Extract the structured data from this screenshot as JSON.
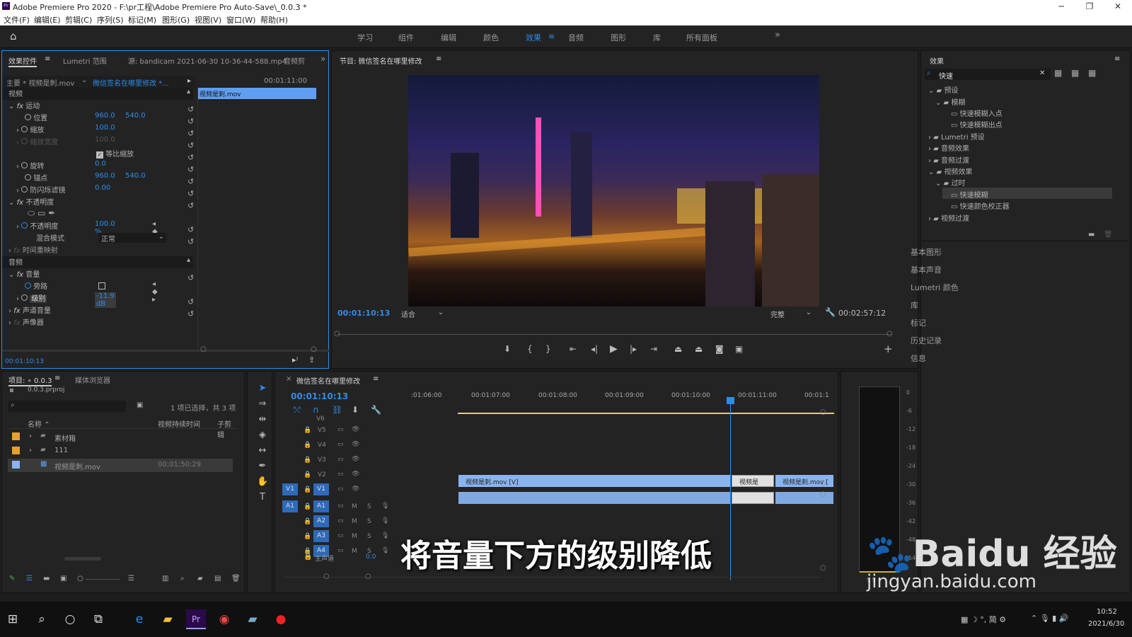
{
  "titlebar": {
    "title": "Adobe Premiere Pro 2020 - F:\\pr工程\\Adobe Premiere Pro Auto-Save\\_0.0.3 *",
    "minimize": "─",
    "maximize": "❐",
    "close": "✕"
  },
  "menu": [
    "文件(F)",
    "编辑(E)",
    "剪辑(C)",
    "序列(S)",
    "标记(M)",
    "图形(G)",
    "视图(V)",
    "窗口(W)",
    "帮助(H)"
  ],
  "workspaces": [
    "学习",
    "组件",
    "编辑",
    "颜色",
    "效果",
    "音频",
    "图形",
    "库",
    "所有面板"
  ],
  "workspace_more": "»",
  "effect_controls": {
    "tabs": [
      "效果控件",
      "Lumetri 范围",
      "源: bandicam 2021-06-30 10-36-44-588.mp4",
      "音频剪"
    ],
    "master": "主要 * 视频是刺.mov",
    "sequence": "微信签名在哪里修改 *...",
    "ruler_time": "00:01:11:00",
    "clip_label": "视频是刺.mov",
    "section_video": "视频",
    "section_audio": "音频",
    "motion": "运动",
    "position": "位置",
    "position_x": "960.0",
    "position_y": "540.0",
    "scale": "缩放",
    "scale_val": "100.0",
    "scale_width": "缩放宽度",
    "scale_width_val": "100.0",
    "uniform": "等比缩放",
    "rotation": "旋转",
    "rotation_val": "0.0",
    "anchor": "锚点",
    "anchor_x": "960.0",
    "anchor_y": "540.0",
    "flicker": "防闪烁滤镜",
    "flicker_val": "0.00",
    "opacity": "不透明度",
    "opacity_prop": "不透明度",
    "opacity_val": "100.0 %",
    "blend": "混合模式",
    "blend_val": "正常",
    "timeremap": "时间重映射",
    "volume": "音量",
    "bypass": "旁路",
    "level": "级别",
    "level_val": "-11.9 dB",
    "channel_vol": "声道音量",
    "panner": "声像器",
    "current_time": "00:01:10:13"
  },
  "program": {
    "title": "节目: 微信签名在哪里修改",
    "timecode": "00:01:10:13",
    "fit": "适合",
    "quality": "完整",
    "duration": "00:02:57:12"
  },
  "effects": {
    "title": "效果",
    "search": "快速",
    "tree": [
      "预设",
      "模糊",
      "快速模糊入点",
      "快速模糊出点",
      "Lumetri 预设",
      "音频效果",
      "音频过渡",
      "视频效果",
      "过时",
      "快速模糊",
      "快速颜色校正器",
      "视频过渡"
    ],
    "side_panels": [
      "基本图形",
      "基本声音",
      "Lumetri 颜色",
      "库",
      "标记",
      "历史记录",
      "信息"
    ]
  },
  "project": {
    "tabs": [
      "项目: ∘ 0.0.3",
      "媒体浏览器"
    ],
    "file": "0.0.3.prproj",
    "selection": "1 项已选择，共 3 项",
    "cols": [
      "名称",
      "视频持续时间",
      "子剪辑"
    ],
    "items": [
      {
        "name": "素材箱",
        "dur": "",
        "color": "#e8a030"
      },
      {
        "name": "111",
        "dur": "",
        "color": "#e8a030"
      },
      {
        "name": "视频是刺.mov",
        "dur": "00;01;50;29",
        "color": "#8ab4f0"
      }
    ]
  },
  "timeline": {
    "title": "微信签名在哪里修改",
    "timecode": "00:01:10:13",
    "ruler": [
      ":01:06:00",
      "00:01:07:00",
      "00:01:08:00",
      "00:01:09:00",
      "00:01:10:00",
      "00:01:11:00",
      "00:01:1"
    ],
    "video_tracks": [
      "V6",
      "V5",
      "V4",
      "V3",
      "V2",
      "V1"
    ],
    "audio_tracks": [
      "A1",
      "A2",
      "A3",
      "A4"
    ],
    "master": "主声道",
    "master_val": "0.0",
    "clips": [
      "视频是刺.mov [V]",
      "视频是",
      "视频是刺.mov ["
    ],
    "meter_ticks": [
      "0",
      "-6",
      "-12",
      "-18",
      "-24",
      "-30",
      "-36",
      "-42",
      "-48",
      "-54"
    ],
    "meter_ss": "S  S"
  },
  "subtitle": "将音量下方的级别降低",
  "watermark": {
    "logo": "Baidu 经验",
    "url": "jingyan.baidu.com"
  },
  "taskbar": {
    "time": "10:52",
    "date": "2021/6/30",
    "ime": "简"
  },
  "colors": {
    "accent": "#2d8ceb",
    "clip_video": "#8ab4f0",
    "clip_audio": "#7fa9e0",
    "playhead": "#2d8ceb"
  }
}
